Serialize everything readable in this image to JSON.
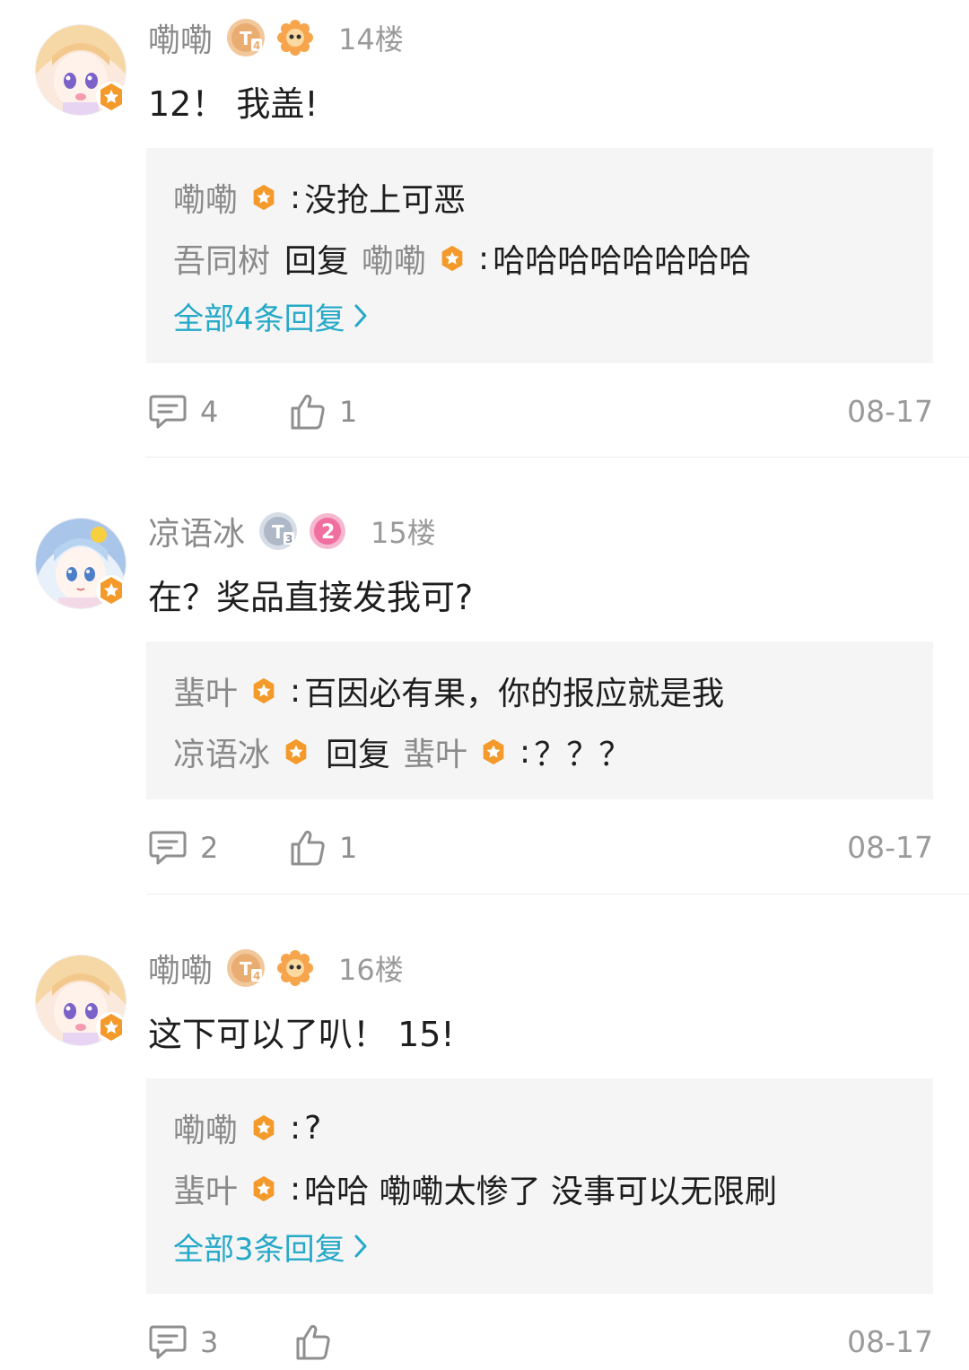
{
  "posts": [
    {
      "username": "嘞嘞",
      "floor": "14楼",
      "level": "T4",
      "content": "12！ 我盖!",
      "replies": [
        {
          "name": "嘞嘞",
          "sep": ":",
          "text": "没抢上可恶"
        },
        {
          "name": "吾同树",
          "reply_word": "回复",
          "target": "嘞嘞",
          "sep": ":",
          "text": "哈哈哈哈哈哈哈哈"
        }
      ],
      "more_link": "全部4条回复",
      "comment_count": "4",
      "like_count": "1",
      "date": "08-17"
    },
    {
      "username": "凉语冰",
      "floor": "15楼",
      "level": "T3",
      "fan_badge": "2",
      "content": "在？奖品直接发我可?",
      "replies": [
        {
          "name": "蜚叶",
          "sep": ":",
          "text": "百因必有果，你的报应就是我"
        },
        {
          "name": "凉语冰",
          "reply_word": "回复",
          "target": "蜚叶",
          "sep": ":",
          "text": "？？？"
        }
      ],
      "comment_count": "2",
      "like_count": "1",
      "date": "08-17"
    },
    {
      "username": "嘞嘞",
      "floor": "16楼",
      "level": "T4",
      "content": "这下可以了叭！ 15!",
      "replies": [
        {
          "name": "嘞嘞",
          "sep": ":",
          "text": "?"
        },
        {
          "name": "蜚叶",
          "sep": ":",
          "text": "哈哈 嘞嘞太惨了 没事可以无限刷"
        }
      ],
      "more_link": "全部3条回复",
      "comment_count": "3",
      "like_count": "",
      "date": "08-17"
    }
  ],
  "colors": {
    "accent_link": "#25a9c8",
    "verified_badge": "#f39a2b",
    "reply_box_bg": "#f5f5f5",
    "username": "#8a8a8a",
    "fan_badge": "#f06fa0"
  },
  "icons": {
    "comment": "comment-icon",
    "like": "thumbs-up-icon",
    "verified": "verified-badge-icon",
    "more": "chevron-right-icon"
  }
}
